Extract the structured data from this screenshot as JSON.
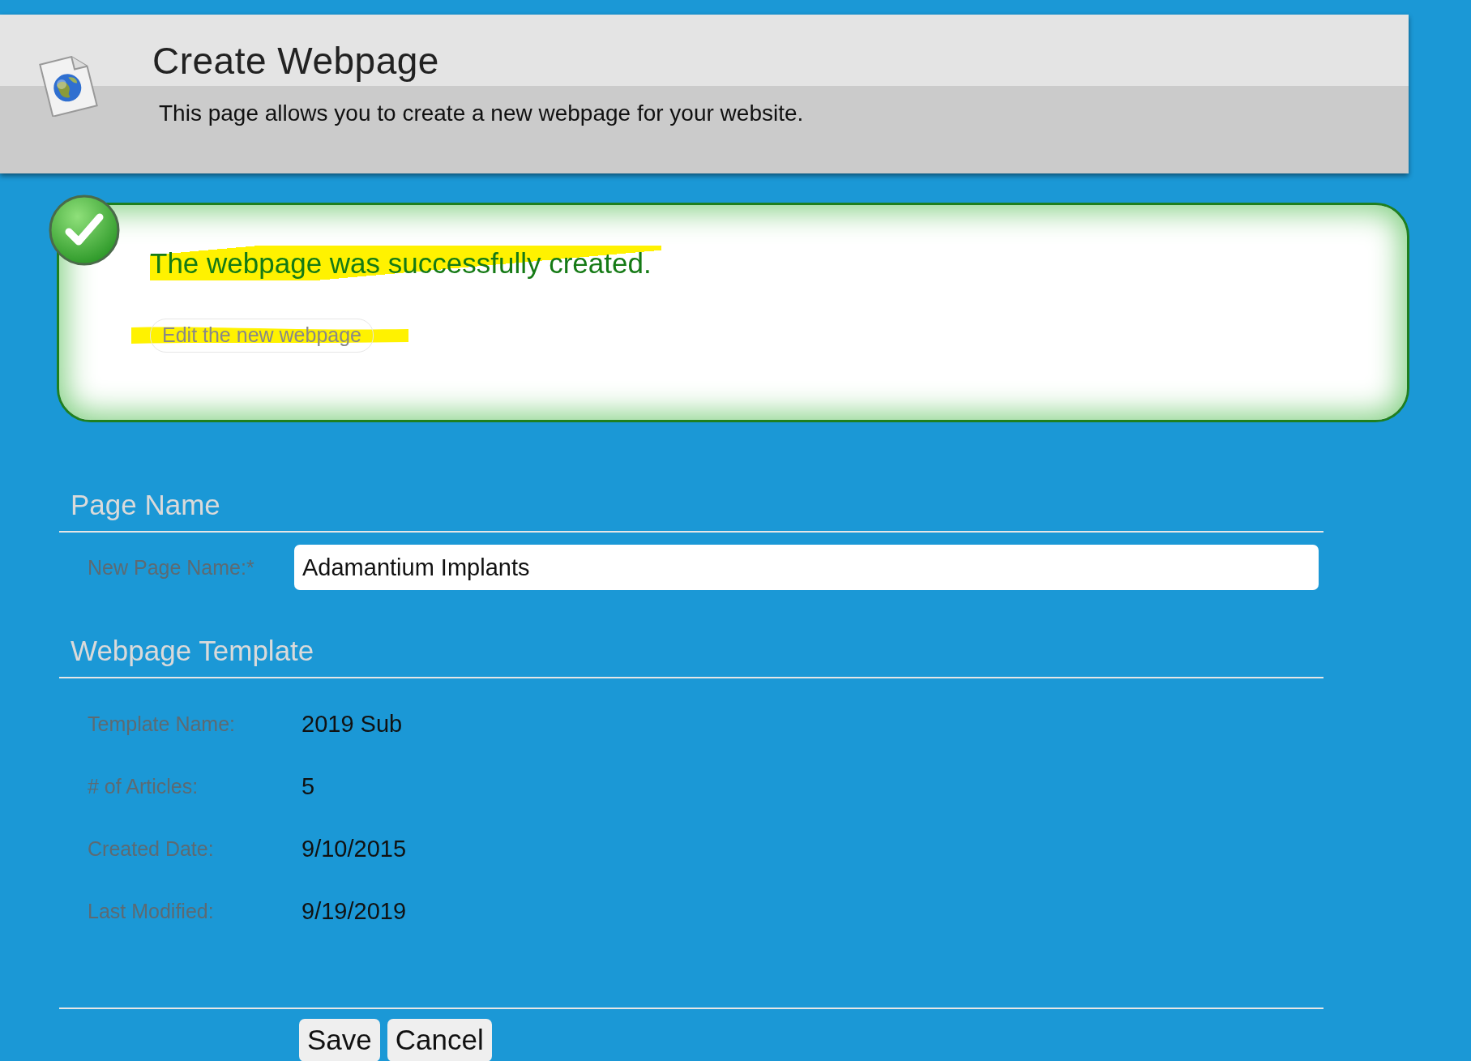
{
  "header": {
    "title": "Create Webpage",
    "subtitle": "This page allows you to create a new webpage for your website."
  },
  "success": {
    "message": "The webpage was successfully created.",
    "link": "Edit the new webpage"
  },
  "sections": [
    {
      "title": "Page Name",
      "fields": [
        {
          "kind": "input",
          "label": "New Page Name:*",
          "value": "Adamantium Implants"
        }
      ]
    },
    {
      "title": "Webpage Template",
      "fields": [
        {
          "kind": "text",
          "label": "Template Name:",
          "value": "2019 Sub"
        },
        {
          "kind": "text",
          "label": "# of Articles:",
          "value": "5"
        },
        {
          "kind": "text",
          "label": "Created Date:",
          "value": "9/10/2015"
        },
        {
          "kind": "text",
          "label": "Last Modified:",
          "value": "9/19/2019"
        }
      ]
    }
  ],
  "buttons": [
    "Save",
    "Cancel"
  ]
}
